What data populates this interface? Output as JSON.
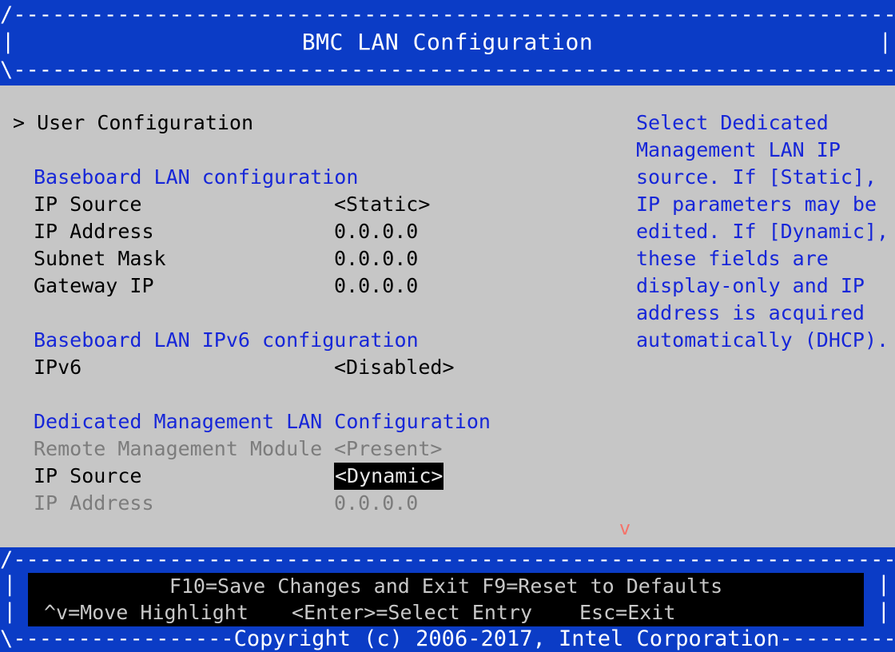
{
  "header": {
    "title": "BMC LAN Configuration",
    "rule_top": "/------------------------------------------------------------------------\\",
    "rule_bottom": "\\------------------------------------------------------------------------/",
    "side_left": "|",
    "side_right": "|"
  },
  "form": {
    "submenu": {
      "marker": ">",
      "label": "User Configuration"
    },
    "groups": [
      {
        "heading": "Baseboard LAN configuration",
        "rows": [
          {
            "label": "IP Source",
            "value": "<Static>",
            "state": "normal",
            "selected": false
          },
          {
            "label": "IP Address",
            "value": "0.0.0.0",
            "state": "normal",
            "selected": false
          },
          {
            "label": "Subnet Mask",
            "value": "0.0.0.0",
            "state": "normal",
            "selected": false
          },
          {
            "label": "Gateway IP",
            "value": "0.0.0.0",
            "state": "normal",
            "selected": false
          }
        ]
      },
      {
        "heading": "Baseboard LAN IPv6 configuration",
        "rows": [
          {
            "label": "IPv6",
            "value": "<Disabled>",
            "state": "normal",
            "selected": false
          }
        ]
      },
      {
        "heading": "Dedicated Management LAN Configuration",
        "rows": [
          {
            "label": "Remote Management Module",
            "value": "<Present>",
            "state": "disabled",
            "selected": false
          },
          {
            "label": "IP Source",
            "value": "<Dynamic>",
            "state": "normal",
            "selected": true
          },
          {
            "label": "IP Address",
            "value": "0.0.0.0",
            "state": "disabled",
            "selected": false
          }
        ]
      }
    ]
  },
  "help": {
    "lines": [
      "Select Dedicated",
      "Management LAN IP",
      "source. If [Static],",
      "IP parameters may be",
      "edited. If [Dynamic],",
      "these fields are",
      "display-only and IP",
      "address is acquired",
      "automatically (DHCP)."
    ]
  },
  "scroll": {
    "down_indicator": "v"
  },
  "footer": {
    "rule_top": "/------------------------------------------------------------------------\\",
    "rule_bottom": "\\-----------------Copyright (c) 2006-2017, Intel Corporation-----------------/",
    "side_left_1": "|",
    "side_left_2": "|",
    "side_right_1": "|",
    "side_right_2": "|",
    "line1": "F10=Save Changes and Exit F9=Reset to Defaults",
    "key_move": "^v=Move Highlight",
    "key_enter": "<Enter>=Select Entry",
    "key_esc": "Esc=Exit"
  },
  "colors": {
    "panel_blue": "#0b3cc6",
    "background_grey": "#c6c6c6",
    "heading_blue": "#1626d8",
    "disabled_grey": "#7c7c7c",
    "selection_bg": "#000000",
    "selection_fg": "#e8e8e8",
    "scroll_indicator": "#f4736a"
  }
}
